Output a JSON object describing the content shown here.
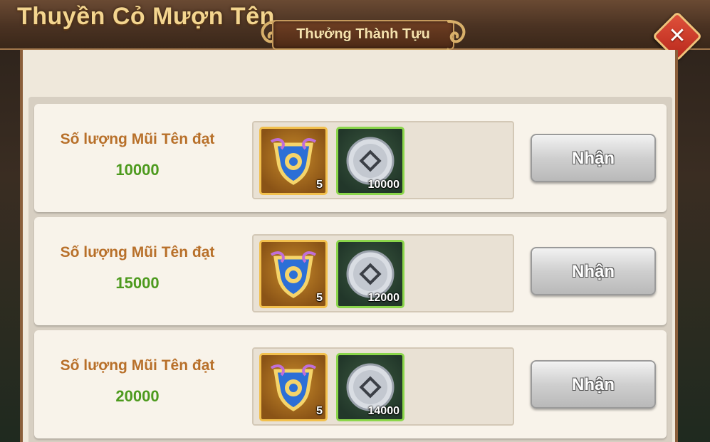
{
  "window": {
    "title": "Thuyền Cỏ Mượn Tên",
    "panel_title": "Thưởng Thành Tựu",
    "close_symbol": "✕"
  },
  "rows": [
    {
      "label": "Số lượng Mũi Tên đạt",
      "target": "10000",
      "rewards": [
        {
          "icon": "badge-icon",
          "quantity": "5"
        },
        {
          "icon": "silver-coin-icon",
          "quantity": "10000"
        }
      ],
      "button_label": "Nhận"
    },
    {
      "label": "Số lượng Mũi Tên đạt",
      "target": "15000",
      "rewards": [
        {
          "icon": "badge-icon",
          "quantity": "5"
        },
        {
          "icon": "silver-coin-icon",
          "quantity": "12000"
        }
      ],
      "button_label": "Nhận"
    },
    {
      "label": "Số lượng Mũi Tên đạt",
      "target": "20000",
      "rewards": [
        {
          "icon": "badge-icon",
          "quantity": "5"
        },
        {
          "icon": "silver-coin-icon",
          "quantity": "14000"
        }
      ],
      "button_label": "Nhận"
    }
  ],
  "colors": {
    "label": "#b8702a",
    "target": "#4d9a1e",
    "badge_border": "#f2c04d",
    "coin_border": "#8bd64b"
  }
}
